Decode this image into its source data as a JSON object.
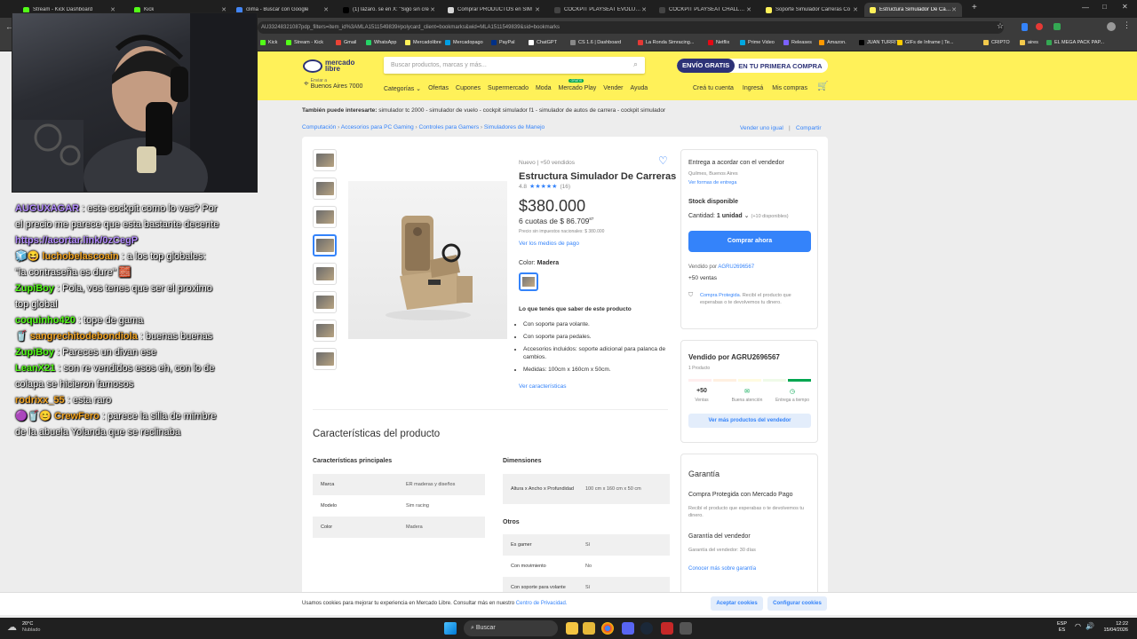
{
  "browser": {
    "tabs": [
      {
        "label": "Stream - Kick Dashboard",
        "color": "#53fc18"
      },
      {
        "label": "Kick",
        "color": "#53fc18"
      },
      {
        "label": "clima - Buscar con Google",
        "color": "#4285f4"
      },
      {
        "label": "(1) lázaro. se en X: \"Sigo sin cre",
        "color": "#000000"
      },
      {
        "label": "Comprar PRODUCTOS en SIM",
        "color": "#d7d7d7"
      },
      {
        "label": "COCKPIT PLAYSEAT EVOLUTIO",
        "color": "#444444"
      },
      {
        "label": "COCKPIT PLAYSEAT CHALLENG",
        "color": "#444444"
      },
      {
        "label": "Soporte Simulador Carreras Co",
        "color": "#fff159"
      },
      {
        "label": "Estructura Simulador De Carre",
        "color": "#fff159",
        "active": true
      }
    ],
    "url": "AU33248321087pdp_filters=item_id%3AMLA1511549839#polycard_client=bookmarks&wid=MLA1511549839&sid=bookmarks",
    "bookmarks": [
      {
        "label": "Kick",
        "color": "#53fc18"
      },
      {
        "label": "Stream - Kick",
        "color": "#53fc18"
      },
      {
        "label": "Gmail",
        "color": "#ea4335"
      },
      {
        "label": "WhatsApp",
        "color": "#25d366"
      },
      {
        "label": "Mercadolibre",
        "color": "#fff159"
      },
      {
        "label": "Mercadopago",
        "color": "#009ee3"
      },
      {
        "label": "PayPal",
        "color": "#003087"
      },
      {
        "label": "ChatGPT",
        "color": "#ffffff"
      },
      {
        "label": "CS 1.6 | Dashboard",
        "color": "#888888"
      },
      {
        "label": "La Ronda Simracing...",
        "color": "#e53935"
      },
      {
        "label": "Netflix",
        "color": "#e50914"
      },
      {
        "label": "Prime Video",
        "color": "#00a8e1"
      },
      {
        "label": "Releases",
        "color": "#7b61ff"
      },
      {
        "label": "Amazon.",
        "color": "#ff9900"
      },
      {
        "label": "JUAN TURRITO",
        "color": "#000000"
      },
      {
        "label": "GIFs de Inframe | Te...",
        "color": "#ffcc00"
      },
      {
        "label": "CRIPTO",
        "color": "#f2c94c"
      },
      {
        "label": "aires",
        "color": "#f2c94c"
      },
      {
        "label": "EL MEGA PACK PAP...",
        "color": "#34a853"
      }
    ]
  },
  "chat": [
    {
      "user": "AUGUXAGAR",
      "color": "#b48cff",
      "text": " : este cockpit como lo ves? Por el precio me parece que esta bastante decente",
      "badges": ""
    },
    {
      "user": "",
      "color": "#b48cff",
      "text": "https://acortar.link/0zCegP",
      "badges": "",
      "link": true
    },
    {
      "user": "luchobelascoain",
      "color": "#f5a623",
      "text": " : a los top globales: \"la contraseña es dure\" 🧱",
      "badges": "🧊😆 "
    },
    {
      "user": "ZupiBoy",
      "color": "#53fc18",
      "text": " : Pola, vos tenes que ser el proximo top global",
      "badges": ""
    },
    {
      "user": "coquinho420",
      "color": "#53fc18",
      "text": " : tope de gama",
      "badges": ""
    },
    {
      "user": "sangrechitodebondiola",
      "color": "#f5a623",
      "text": " : buenas buenas",
      "badges": "🥤 "
    },
    {
      "user": "ZupiBoy",
      "color": "#53fc18",
      "text": " : Pareces un divan ese",
      "badges": ""
    },
    {
      "user": "LeanX21",
      "color": "#53fc18",
      "text": " : son re vendidos esos eh, con lo de colapa se hicieron famosos",
      "badges": ""
    },
    {
      "user": "rodrixx_55",
      "color": "#f5a623",
      "text": " : esta raro",
      "badges": ""
    },
    {
      "user": "CrewFero",
      "color": "#f5a623",
      "text": " : parece la silla de mimbre de la abuela Yolanda que se reclinaba",
      "badges": "🟣🥤😊 "
    }
  ],
  "ml": {
    "logo": "mercado libre",
    "search_placeholder": "Buscar productos, marcas y más...",
    "promo_prefix": "ENVÍO GRATIS",
    "promo_suffix": "EN TU PRIMERA COMPRA",
    "location_top": "Enviar a",
    "location": "Buenos Aires 7000",
    "nav": [
      "Categorías ⌄",
      "Ofertas",
      "Cupones",
      "Supermercado",
      "Moda",
      "Mercado Play",
      "Vender",
      "Ayuda"
    ],
    "mp_badge": "GRATIS",
    "account": [
      "Creá tu cuenta",
      "Ingresá",
      "Mis compras"
    ],
    "related_label": "También puede interesarte:",
    "related": "simulador tc 2000 - simulador de vuelo - cockpit simulador f1 - simulador de autos de carrera - cockpit simulador",
    "breadcrumb": [
      "Computación",
      "Accesorios para PC Gaming",
      "Controles para Gamers",
      "Simuladores de Manejo"
    ],
    "sell_link": "Vender uno igual",
    "share_link": "Compartir",
    "product": {
      "condition": "Nuevo  |  +50 vendidos",
      "title": "Estructura Simulador De Carreras",
      "rating": "4.8",
      "stars": "★★★★★",
      "reviews": "(16)",
      "price_symbol": "$",
      "price": "380.000",
      "installments": "6 cuotas de $ 86.709",
      "installments_cents": "87",
      "no_tax": "Precio sin impuestos nacionales: $ 380.000",
      "payment_link": "Ver los medios de pago",
      "color_label": "Color:",
      "color_value": "Madera",
      "features_title": "Lo que tenés que saber de este producto",
      "features": [
        "Con soporte para volante.",
        "Con soporte para pedales.",
        "Accesorios incluidos: soporte adicional para palanca de cambios.",
        "Medidas: 100cm x 160cm x 50cm."
      ],
      "features_link": "Ver características"
    },
    "buy": {
      "delivery": "Entrega a acordar con el vendedor",
      "delivery_loc": "Quilmes, Buenos Aires",
      "delivery_link": "Ver formas de entrega",
      "stock": "Stock disponible",
      "quantity_label": "Cantidad:",
      "quantity_value": "1 unidad",
      "quantity_more": "(+10 disponibles)",
      "buy_button": "Comprar ahora",
      "seller_prefix": "Vendido por",
      "seller": "AGRU2696567",
      "sales": "+50 ventas",
      "protected_link": "Compra Protegida",
      "protected_text": ". Recibí el producto que esperabas o te devolvemos tu dinero."
    },
    "seller_card": {
      "title": "Vendido por AGRU2696567",
      "products": "1 Producto",
      "stat1_value": "+50",
      "stat1_label": "Ventas",
      "stat2_label": "Buena atención",
      "stat3_label": "Entrega a tiempo",
      "more_button": "Ver más productos del vendedor"
    },
    "specs": {
      "title": "Características del producto",
      "main_title": "Características principales",
      "main": [
        [
          "Marca",
          "ER maderas y diseños"
        ],
        [
          "Modelo",
          "Sim racing"
        ],
        [
          "Color",
          "Madera"
        ]
      ],
      "dims_title": "Dimensiones",
      "dims": [
        [
          "Altura x Ancho x Profundidad",
          "100 cm x 160 cm x 50 cm"
        ]
      ],
      "other_title": "Otros",
      "other": [
        [
          "Es gamer",
          "Sí"
        ],
        [
          "Con movimiento",
          "No"
        ],
        [
          "Con soporte para volante",
          "Sí"
        ]
      ]
    },
    "warranty": {
      "title": "Garantía",
      "protected_title": "Compra Protegida con Mercado Pago",
      "protected_text": "Recibí el producto que esperabas o te devolvemos tu dinero.",
      "seller_title": "Garantía del vendedor",
      "seller_text": "Garantía del vendedor: 30 días",
      "link": "Conocer más sobre garantía"
    },
    "cookie": {
      "text": "Usamos cookies para mejorar tu experiencia en Mercado Libre. Consultar más en nuestro",
      "link": "Centro de Privacidad.",
      "accept": "Aceptar cookies",
      "configure": "Configurar cookies"
    }
  },
  "taskbar": {
    "weather_temp": "20°C",
    "weather_desc": "Nublado",
    "search": "Buscar",
    "lang_top": "ESP",
    "lang_bottom": "ES",
    "time": "12:22",
    "date": "15/04/2026"
  }
}
